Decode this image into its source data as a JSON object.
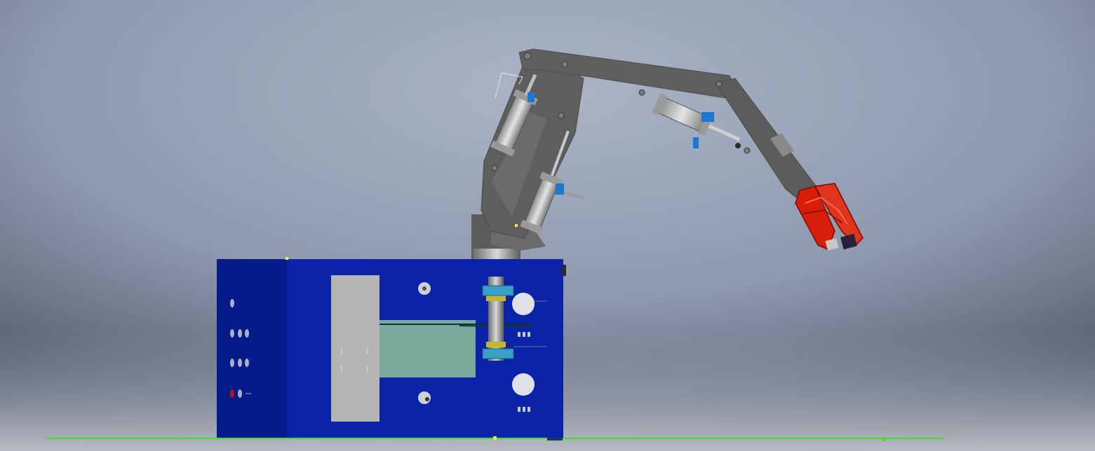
{
  "view": {
    "background_center": "#a4aec2",
    "background_edge": "#4b5163",
    "ground_line_color": "#39e61a"
  },
  "cabinet": {
    "front_color": "#0a23a8",
    "side_color": "#061b8a",
    "panel_color": "#b4b4b4",
    "window_color": "#7aa89a"
  },
  "arm": {
    "link_color": "#626262",
    "cylinder_color": "#c8c8c8",
    "fitting_color": "#1e78d2",
    "gripper_color": "#d81e0a"
  }
}
